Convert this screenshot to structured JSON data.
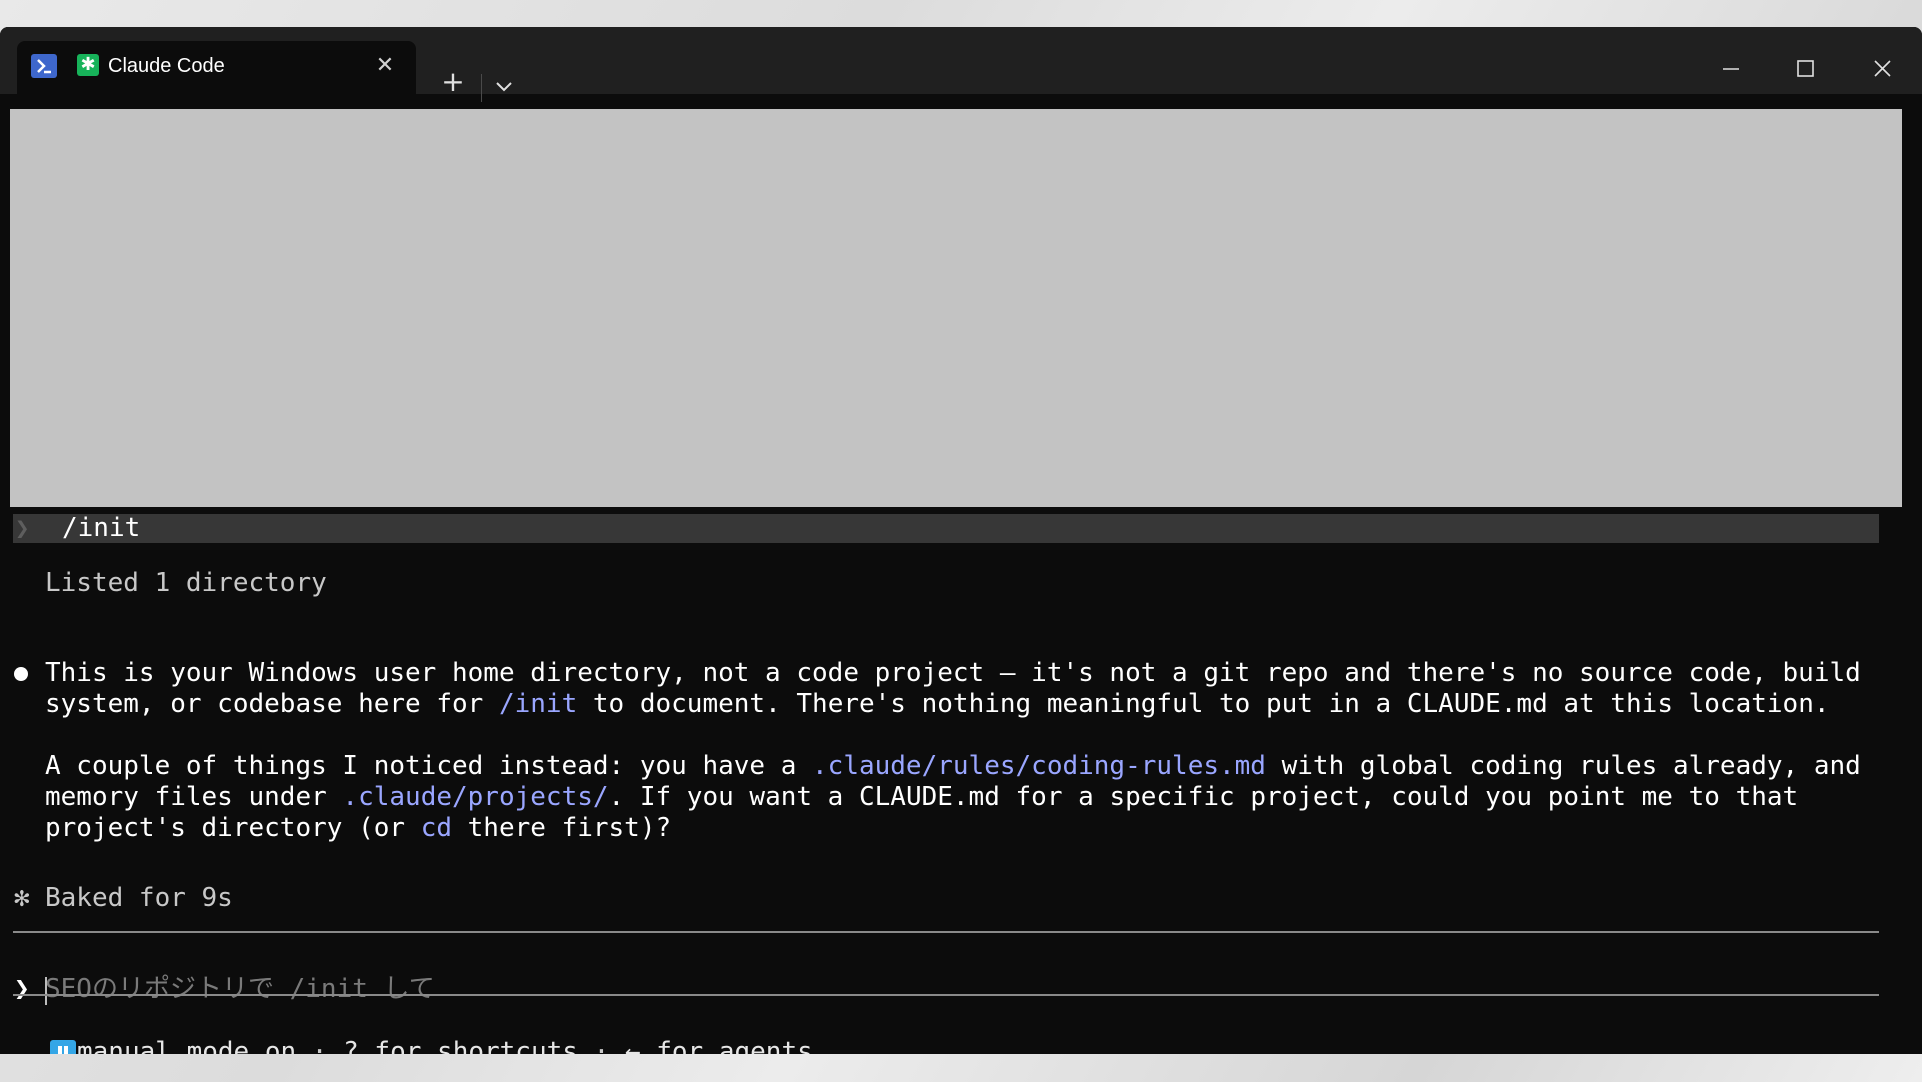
{
  "window": {
    "tab_title": "Claude Code",
    "tab_icon": "claude-asterisk-icon",
    "shell_icon": "powershell-icon",
    "accent_green": "#17b35a",
    "accent_blue": "#3e67cc"
  },
  "terminal": {
    "command": "/init",
    "listed": "Listed 1 directory",
    "response_line1": "This is your Windows user home directory, not a code project — it's not a git repo and there's no source code, build",
    "response_line2_a": "system, or codebase here for ",
    "response_line2_link": "/init",
    "response_line2_b": " to document. There's nothing meaningful to put in a CLAUDE.md at this location.",
    "para2_line1_a": "A couple of things I noticed instead: you have a ",
    "para2_line1_link": ".claude/rules/coding-rules.md",
    "para2_line1_b": " with global coding rules already, and",
    "para2_line2_a": "memory files under ",
    "para2_line2_link": ".claude/projects/",
    "para2_line2_b": ". If you want a CLAUDE.md for a specific project, could you point me to that",
    "para2_line3_a": "project's directory (or ",
    "para2_line3_link": "cd",
    "para2_line3_b": " there first)?",
    "baked": "Baked for 9s",
    "spark_glyph": "✻",
    "link_color": "#9aa6ff"
  },
  "prompt": {
    "chevron": "❯",
    "placeholder": "SEOのリポジトリで /init して"
  },
  "statusbar": {
    "mode": "manual mode on",
    "sep1": " · ",
    "shortcuts": "? for shortcuts",
    "sep2": " · ",
    "agents": "← for agents",
    "mode_color": "#34a6e6"
  }
}
